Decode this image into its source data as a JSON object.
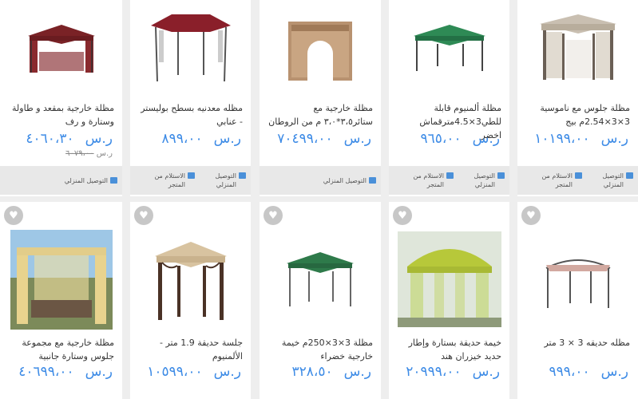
{
  "top_row": [
    {
      "title": "مظلة جلوس مع ناموسية 3×3×2.54م بيج",
      "price": "١٠١٩٩،٠٠",
      "currency": "ر.س",
      "delivery": [
        "التوصيل المنزلي",
        "الاستلام من المتجر"
      ]
    },
    {
      "title": "مظلة ألمنيوم قابلة للطي3×4.5مترقماش اخضر",
      "price": "٩٦٥،٠٠",
      "currency": "ر.س",
      "delivery": [
        "التوصيل المنزلي",
        "الاستلام من المتجر"
      ]
    },
    {
      "title": "مظلة خارجية مع ستائر٣،٥*٣،٠ م من الروطان",
      "price": "٧٠٤٩٩،٠٠",
      "currency": "ر.س",
      "delivery": [
        "التوصيل المنزلي"
      ]
    },
    {
      "title": "مظله معدنيه بسطح بوليستر - عنابي",
      "price": "٨٩٩،٠٠",
      "currency": "ر.س",
      "delivery": [
        "التوصيل المنزلي",
        "الاستلام من المتجر"
      ]
    },
    {
      "title": "مظلة خارجية بمقعد و طاولة وستارة و رف",
      "price": "٤٠٦٠،٣٠",
      "currency": "ر.س",
      "old_price": "٦٠٧٩،٠٠",
      "delivery": [
        "التوصيل المنزلي"
      ]
    }
  ],
  "bottom_row": [
    {
      "title": "مظله حديقه 3 × 3 متر",
      "price": "٩٩٩،٠٠",
      "currency": "ر.س"
    },
    {
      "title": "خيمة حديقة بستارة وإطار حديد خيزران هند",
      "price": "٢٠٩٩٩،٠٠",
      "currency": "ر.س"
    },
    {
      "title": "مظلة 3×3×250م خيمة خارجية خضراء",
      "price": "٣٢٨،٥٠",
      "currency": "ر.س"
    },
    {
      "title": "جلسة حديقة 1.9 متر - الألمنيوم",
      "price": "١٠٥٩٩،٠٠",
      "currency": "ر.س"
    },
    {
      "title": "مظلة خارجية مع مجموعة جلوس وستارة جانبية",
      "price": "٤٠٦٩٩،٠٠",
      "currency": "ر.س"
    }
  ],
  "colors": {
    "price": "#3d8be6",
    "icon": "#4a90d9",
    "heart_bg": "#c7c7c7",
    "bar_bg": "#e8e8e8"
  },
  "icons": {
    "wishlist": "heart-icon",
    "home_delivery": "truck-icon",
    "store_pickup": "store-icon"
  }
}
